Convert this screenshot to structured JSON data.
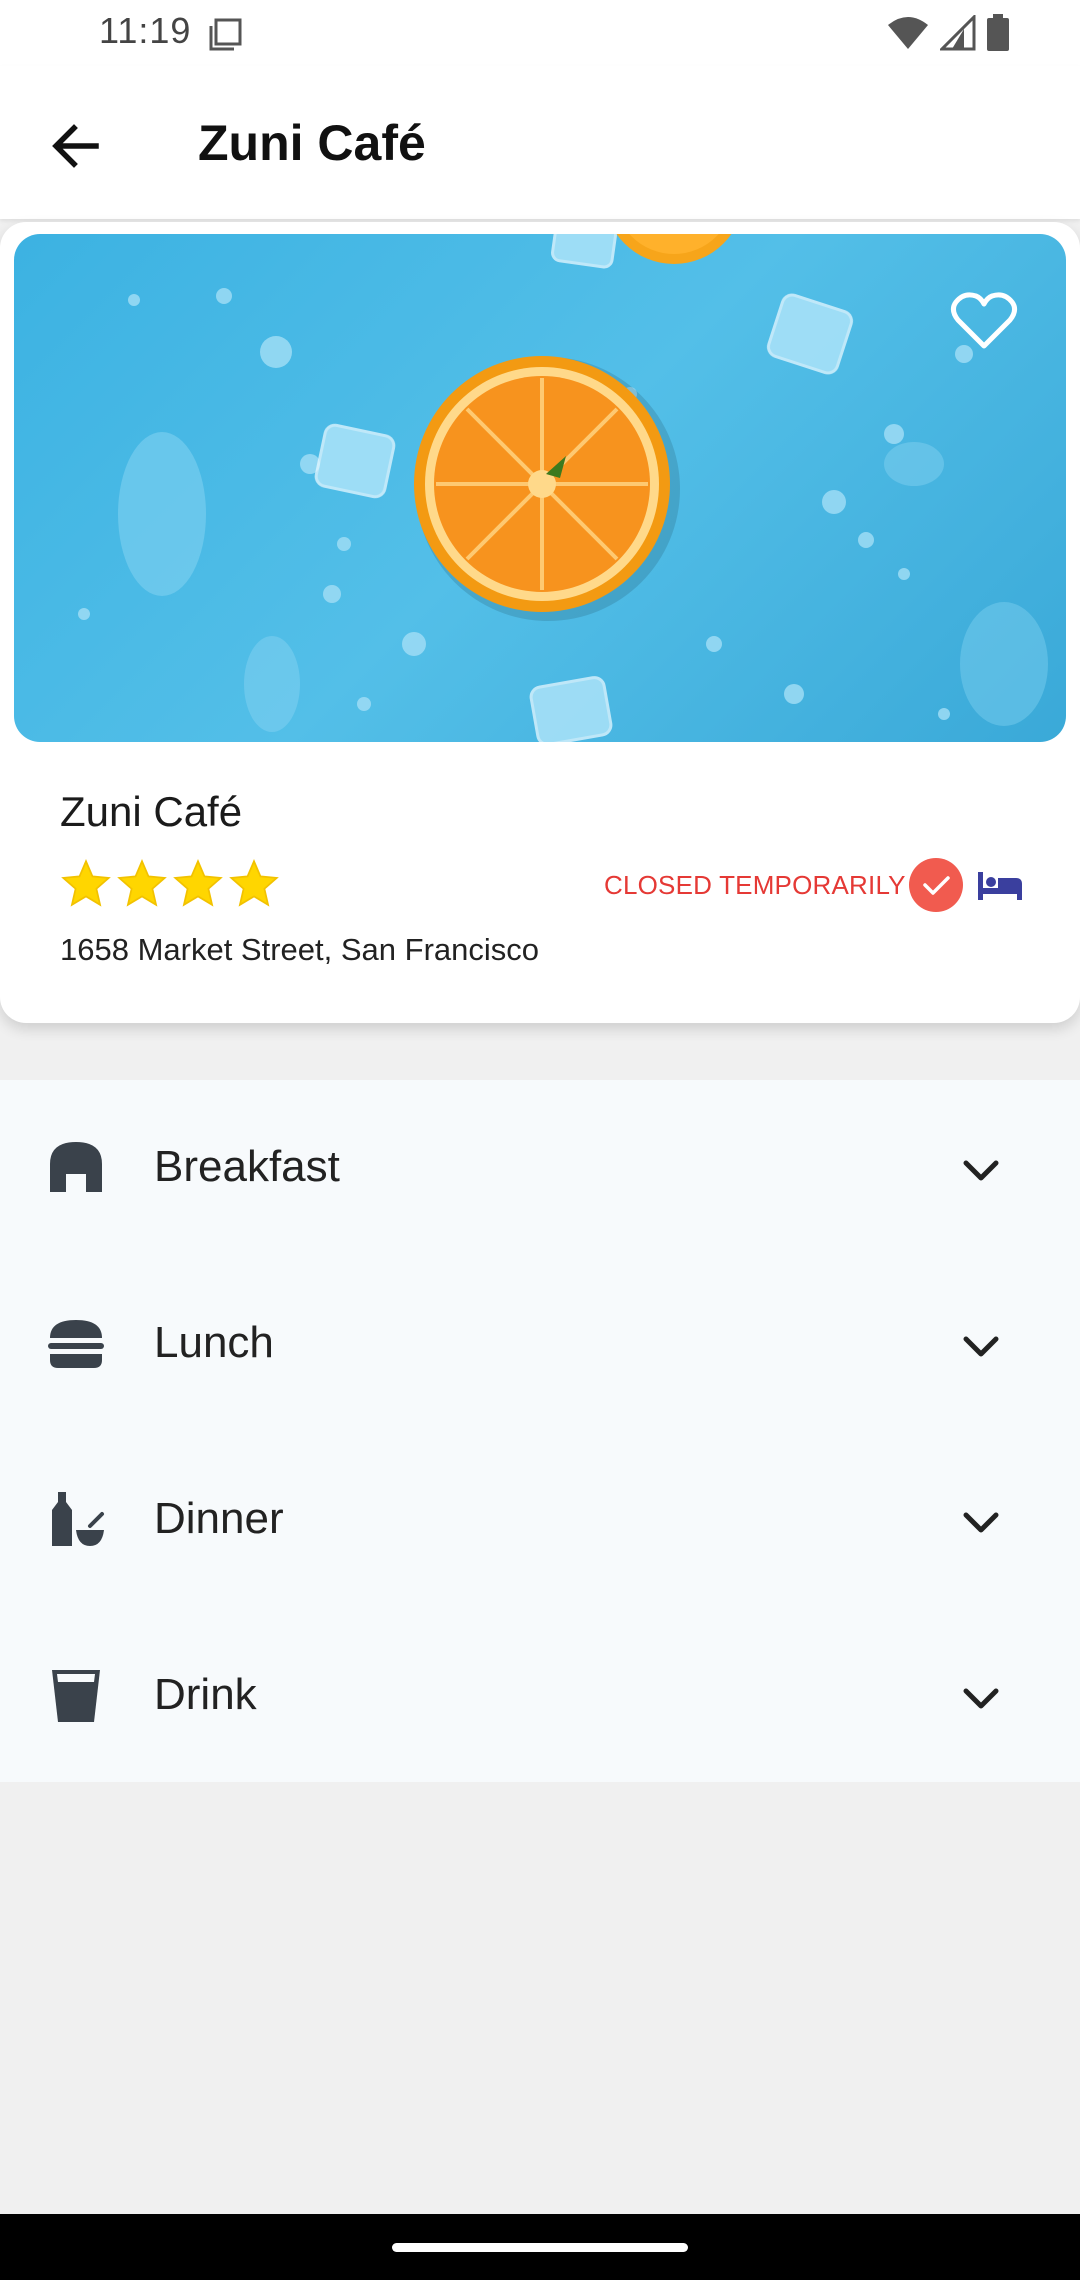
{
  "status_bar": {
    "time": "11:19"
  },
  "app_bar": {
    "title": "Zuni Café",
    "back_icon": "arrow-back-icon"
  },
  "venue": {
    "name": "Zuni Café",
    "rating": 4,
    "rating_max": 4,
    "status": "CLOSED TEMPORARILY",
    "address": "1658 Market Street, San Francisco",
    "colors": {
      "status": "#e53935",
      "star": "#ffd600",
      "badge": "#f15b4f",
      "bed": "#3a3f9e"
    }
  },
  "menu": [
    {
      "label": "Breakfast",
      "icon": "bakery-dining-icon"
    },
    {
      "label": "Lunch",
      "icon": "burger-icon"
    },
    {
      "label": "Dinner",
      "icon": "dinner-icon"
    },
    {
      "label": "Drink",
      "icon": "glass-icon"
    }
  ]
}
